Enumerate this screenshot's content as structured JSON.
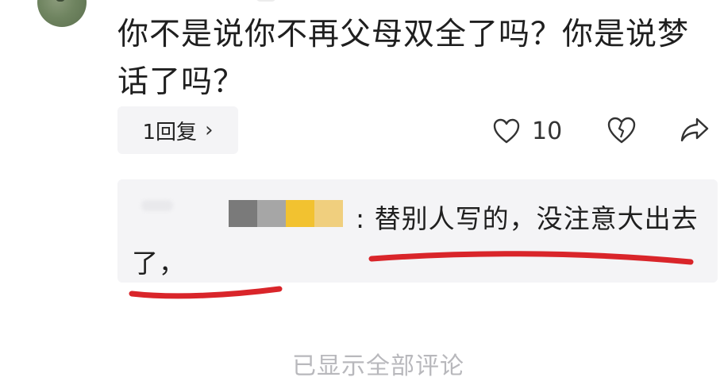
{
  "comment": {
    "text": "你不是说你不再父母双全了吗？你是说梦话了吗？"
  },
  "actions": {
    "reply_label": "1回复",
    "reply_chevron": "›",
    "like_count": "10",
    "icons": [
      "heart-icon",
      "broken-heart-icon",
      "share-icon"
    ]
  },
  "reply": {
    "text": ": 替别人写的，没注意大出去了，",
    "mosaic_colors": [
      "#7a7a7a",
      "#a6a6a6",
      "#f2c230",
      "#f0cf7e"
    ],
    "annotation_color": "#d9252a"
  },
  "footer": {
    "text": "已显示全部评论"
  }
}
